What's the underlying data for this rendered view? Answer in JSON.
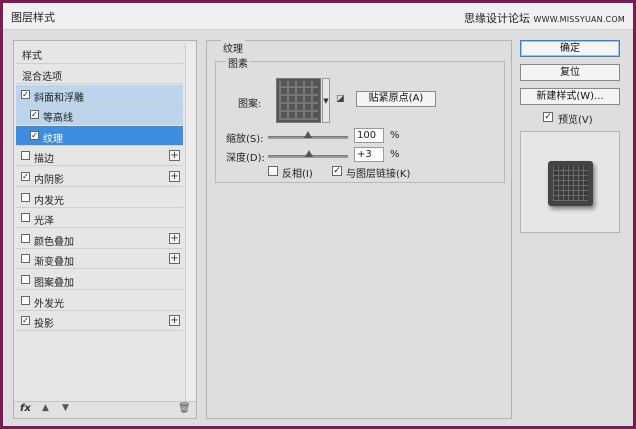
{
  "window": {
    "title": "图层样式",
    "watermark_cn": "思缘设计论坛",
    "watermark_en": "WWW.MISSYUAN.COM"
  },
  "styles_list": {
    "header": "样式",
    "items": [
      {
        "label": "混合选项",
        "checkbox": false,
        "checked": false,
        "plus": false,
        "indent": false,
        "state": "normal"
      },
      {
        "label": "斜面和浮雕",
        "checkbox": true,
        "checked": true,
        "plus": false,
        "indent": false,
        "state": "highlight"
      },
      {
        "label": "等高线",
        "checkbox": true,
        "checked": true,
        "plus": false,
        "indent": true,
        "state": "highlight"
      },
      {
        "label": "纹理",
        "checkbox": true,
        "checked": true,
        "plus": false,
        "indent": true,
        "state": "selected"
      },
      {
        "label": "描边",
        "checkbox": true,
        "checked": false,
        "plus": true,
        "indent": false,
        "state": "normal"
      },
      {
        "label": "内阴影",
        "checkbox": true,
        "checked": true,
        "plus": true,
        "indent": false,
        "state": "normal"
      },
      {
        "label": "内发光",
        "checkbox": true,
        "checked": false,
        "plus": false,
        "indent": false,
        "state": "normal"
      },
      {
        "label": "光泽",
        "checkbox": true,
        "checked": false,
        "plus": false,
        "indent": false,
        "state": "normal"
      },
      {
        "label": "颜色叠加",
        "checkbox": true,
        "checked": false,
        "plus": true,
        "indent": false,
        "state": "normal"
      },
      {
        "label": "渐变叠加",
        "checkbox": true,
        "checked": false,
        "plus": true,
        "indent": false,
        "state": "normal"
      },
      {
        "label": "图案叠加",
        "checkbox": true,
        "checked": false,
        "plus": false,
        "indent": false,
        "state": "normal"
      },
      {
        "label": "外发光",
        "checkbox": true,
        "checked": false,
        "plus": false,
        "indent": false,
        "state": "normal"
      },
      {
        "label": "投影",
        "checkbox": true,
        "checked": true,
        "plus": true,
        "indent": false,
        "state": "normal"
      }
    ],
    "footer": {
      "fx_label": "fx",
      "up_icon": "arrow-up-icon",
      "down_icon": "arrow-down-icon",
      "trash_icon": "trash-icon"
    }
  },
  "texture_panel": {
    "title": "纹理",
    "group_title": "图素",
    "pattern_label": "图案:",
    "snap_button": "贴紧原点(A)",
    "scale_label": "缩放(S):",
    "scale_value": "100",
    "scale_unit": "%",
    "scale_fraction": 0.5,
    "depth_label": "深度(D):",
    "depth_value": "+3",
    "depth_unit": "%",
    "depth_fraction": 0.51,
    "invert_label": "反相(I)",
    "invert_checked": false,
    "link_label": "与图层链接(K)",
    "link_checked": true
  },
  "buttons": {
    "ok": "确定",
    "reset": "复位",
    "new_style": "新建样式(W)...",
    "preview_label": "预览(V)",
    "preview_checked": true
  },
  "colors": {
    "selected_row": "#3d8ee0",
    "highlight_row": "#bcd4ec",
    "frame": "#7a1c54"
  }
}
